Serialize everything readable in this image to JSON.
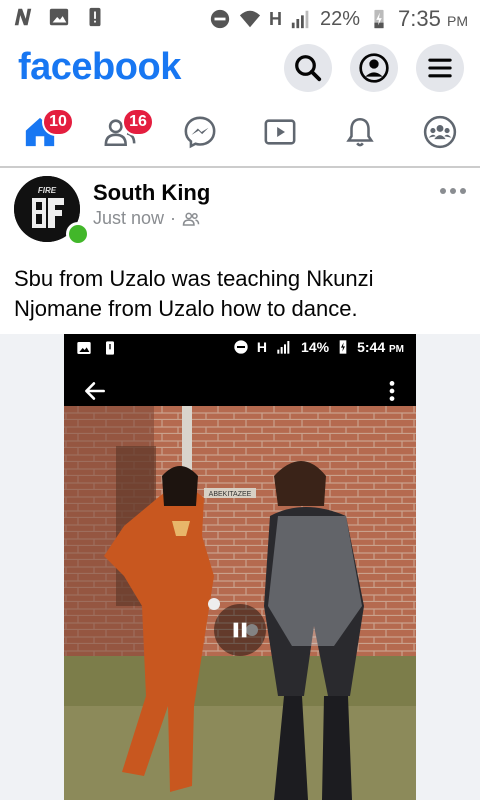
{
  "status_bar": {
    "signal_type": "H",
    "battery": "22%",
    "time": "7:35",
    "ampm": "PM"
  },
  "header": {
    "logo": "facebook",
    "icons": [
      "search-icon",
      "profile-icon",
      "menu-icon"
    ]
  },
  "nav": {
    "items": [
      {
        "name": "home",
        "badge": "10"
      },
      {
        "name": "friends",
        "badge": "16"
      },
      {
        "name": "messenger",
        "badge": ""
      },
      {
        "name": "watch",
        "badge": ""
      },
      {
        "name": "notifications",
        "badge": ""
      },
      {
        "name": "groups",
        "badge": ""
      }
    ]
  },
  "post": {
    "author": "South King",
    "time": "Just now",
    "separator": "·",
    "text": "Sbu from Uzalo was teaching Nkunzi Njomane from Uzalo how to dance.",
    "avatar_text": "FIRE"
  },
  "video": {
    "status_bar": {
      "signal_type": "H",
      "battery": "14%",
      "time": "5:44",
      "ampm": "PM"
    },
    "sign_text": "ABEKITAZEE"
  },
  "colors": {
    "brand": "#1877F2",
    "badge": "#e41e3f",
    "online": "#42b72a"
  }
}
